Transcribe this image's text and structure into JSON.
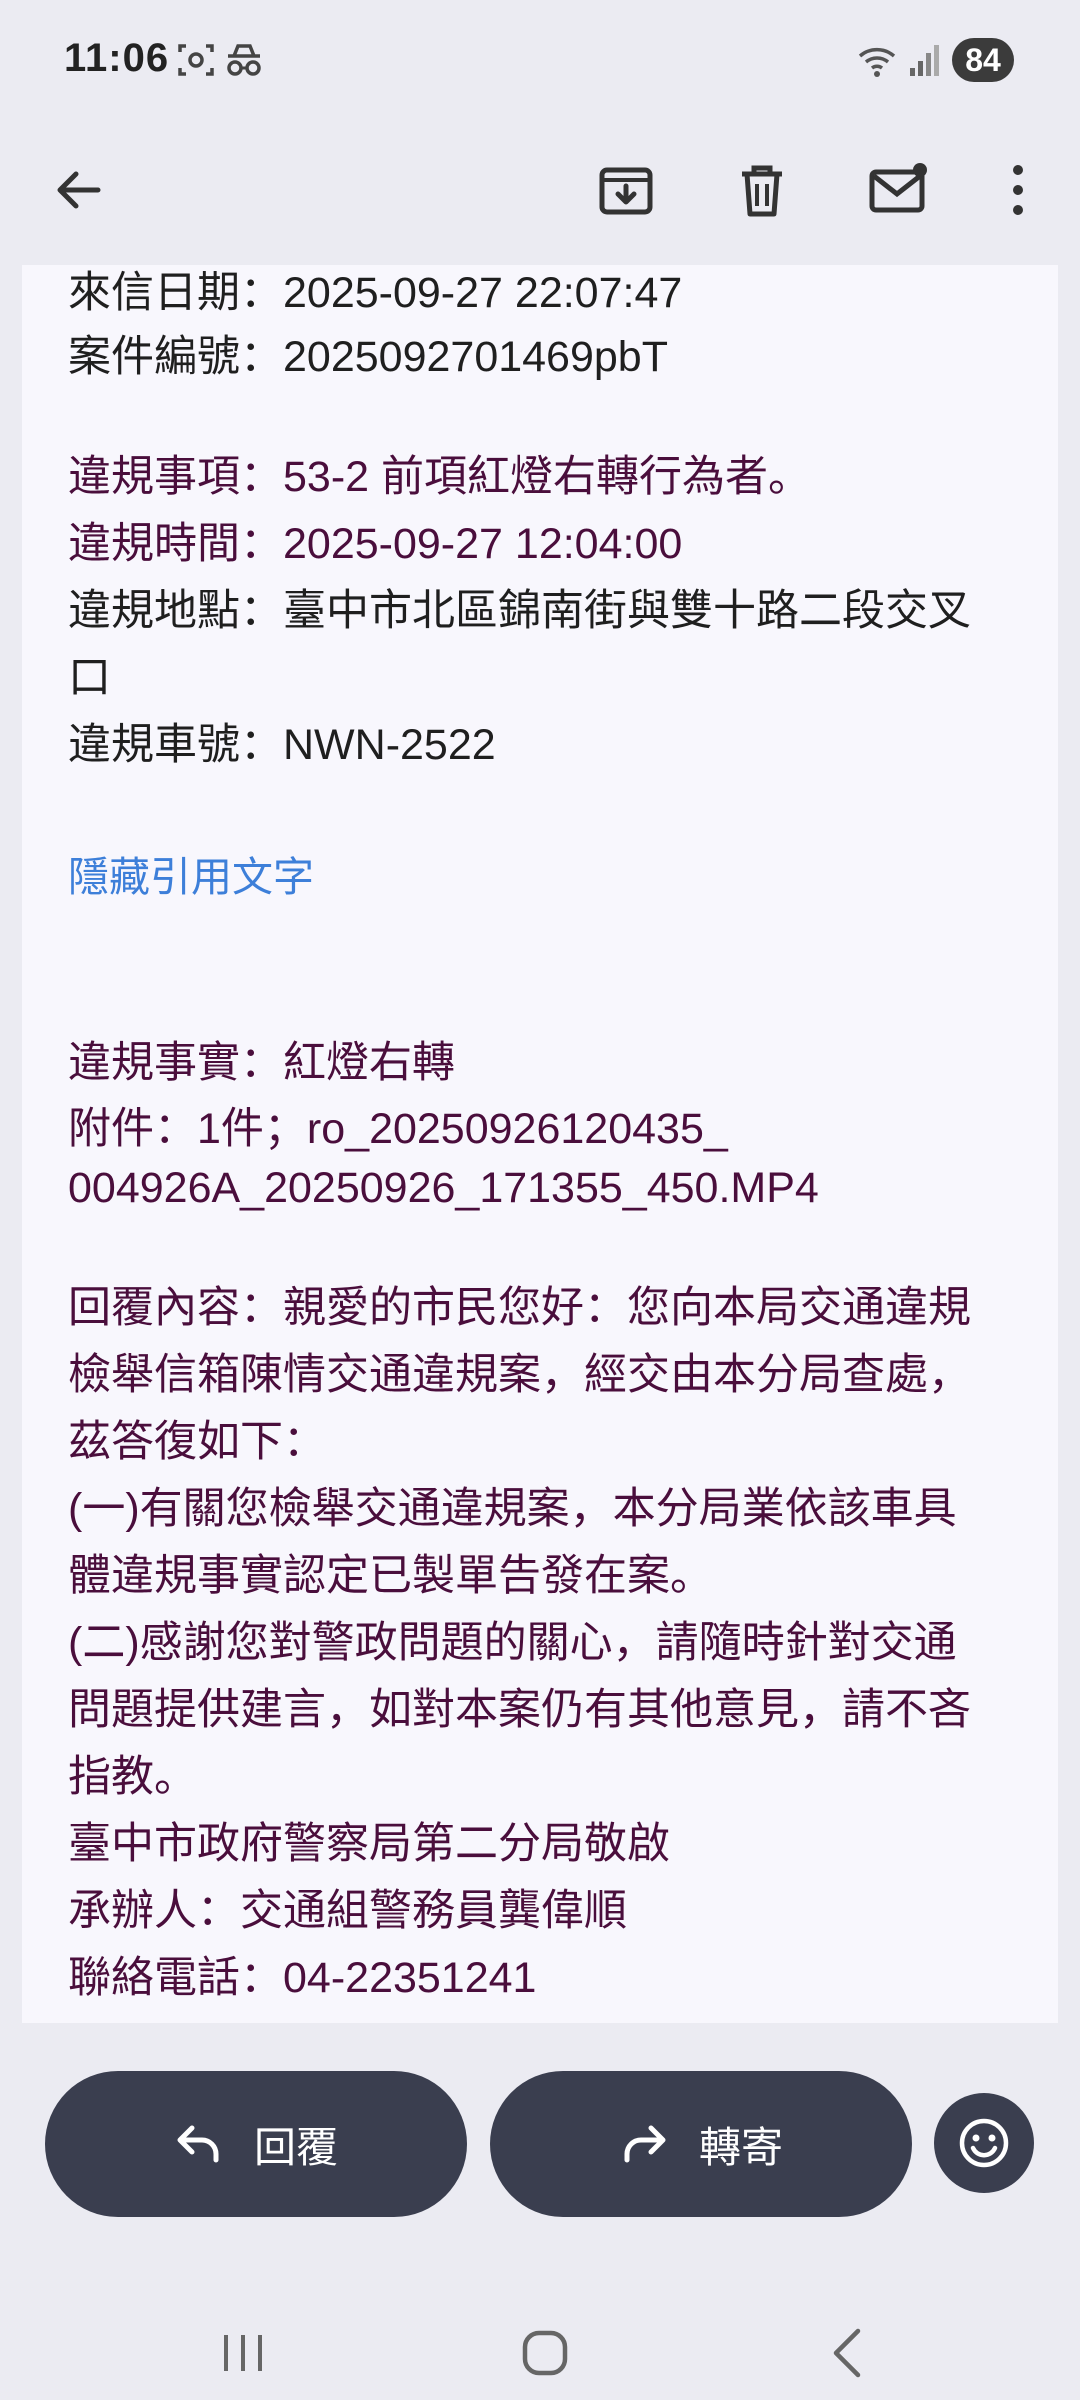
{
  "status_bar": {
    "time": "11:06",
    "battery": "84",
    "icons": [
      "screenshot-icon",
      "incognito-icon",
      "wifi-icon",
      "signal-icon"
    ]
  },
  "toolbar": {
    "icons": [
      "back-arrow-icon",
      "archive-icon",
      "delete-icon",
      "mark-unread-icon",
      "more-vert-icon"
    ]
  },
  "email": {
    "received_date": "來信日期：2025-09-27 22:07:47",
    "case_number": "案件編號：2025092701469pbT",
    "violation_item": "違規事項：53-2 前項紅燈右轉行為者。",
    "violation_time": "違規時間：2025-09-27 12:04:00",
    "violation_location_1": "違規地點：臺中市北區錦南街與雙十路二段交叉",
    "violation_location_2": "口",
    "plate": "違規車號：NWN-2522",
    "hide_quoted": "隱藏引用文字",
    "violation_fact": "違規事實：紅燈右轉",
    "attachment_1": "附件：1件；ro_20250926120435_",
    "attachment_2": "004926A_20250926_171355_450.MP4",
    "reply_lines": [
      "回覆內容：親愛的市民您好：您向本局交通違規",
      "檢舉信箱陳情交通違規案，經交由本分局查處，",
      "茲答復如下：",
      "(一)有關您檢舉交通違規案，本分局業依該車具",
      "體違規事實認定已製單告發在案。",
      "(二)感謝您對警政問題的關心，請隨時針對交通",
      "問題提供建言，如對本案仍有其他意見，請不吝",
      "指教。",
      "臺中市政府警察局第二分局敬啟",
      "承辦人：交通組警務員龔偉順",
      "聯絡電話：04-22351241"
    ]
  },
  "actions": {
    "reply_label": "回覆",
    "forward_label": "轉寄"
  },
  "colors": {
    "background": "#ebebf2",
    "card": "#f8f7fd",
    "pill": "#3a3e4f",
    "link": "#3d7fd9",
    "quoted_text": "#4a0e3c"
  }
}
